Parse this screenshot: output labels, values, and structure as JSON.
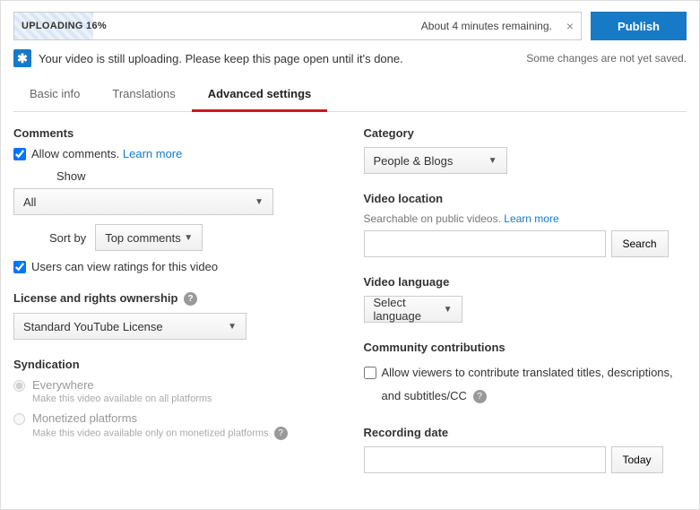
{
  "header": {
    "upload_status": "UPLOADING 16%",
    "remaining": "About 4 minutes remaining.",
    "publish": "Publish"
  },
  "notice": {
    "icon": "✱",
    "text": "Your video is still uploading. Please keep this page open until it's done.",
    "saved": "Some changes are not yet saved."
  },
  "tabs": {
    "basic": "Basic info",
    "translations": "Translations",
    "advanced": "Advanced settings"
  },
  "comments": {
    "title": "Comments",
    "allow": "Allow comments.",
    "learn": "Learn more",
    "show_label": "Show",
    "show_value": "All",
    "sort_label": "Sort by",
    "sort_value": "Top comments",
    "ratings": "Users can view ratings for this video"
  },
  "license": {
    "title": "License and rights ownership",
    "value": "Standard YouTube License"
  },
  "syndication": {
    "title": "Syndication",
    "opt1": "Everywhere",
    "opt1_hint": "Make this video available on all platforms",
    "opt2": "Monetized platforms",
    "opt2_hint": "Make this video available only on monetized platforms"
  },
  "category": {
    "title": "Category",
    "value": "People & Blogs"
  },
  "location": {
    "title": "Video location",
    "hint": "Searchable on public videos.",
    "learn": "Learn more",
    "search": "Search"
  },
  "language": {
    "title": "Video language",
    "value": "Select language"
  },
  "contributions": {
    "title": "Community contributions",
    "text1": "Allow viewers to contribute translated titles, descriptions,",
    "text2": "and subtitles/CC"
  },
  "recording": {
    "title": "Recording date",
    "today": "Today"
  }
}
